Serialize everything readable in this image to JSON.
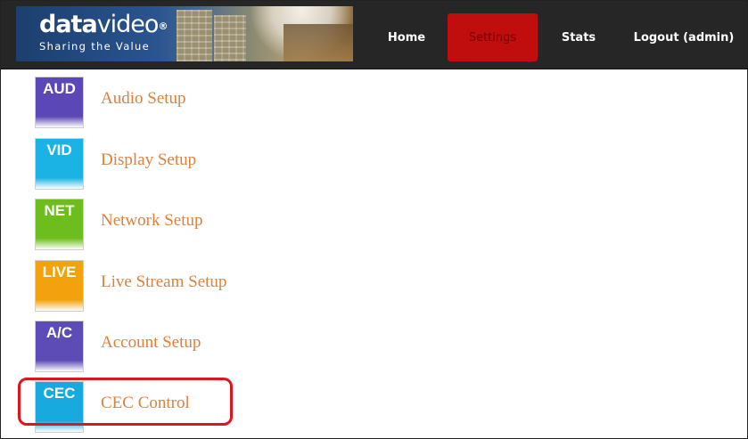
{
  "header": {
    "logo_bold": "data",
    "logo_thin": "video",
    "logo_reg": "®",
    "tagline": "Sharing the Value",
    "nav": [
      {
        "label": "Home",
        "active": false
      },
      {
        "label": "Settings",
        "active": true
      },
      {
        "label": "Stats",
        "active": false
      },
      {
        "label": "Logout (admin)",
        "active": false
      }
    ]
  },
  "menu": [
    {
      "tile": "AUD",
      "label": "Audio Setup",
      "color": "#5b47b5",
      "icon": "audio-tile-icon"
    },
    {
      "tile": "VID",
      "label": "Display Setup",
      "color": "#1ab3e3",
      "icon": "video-tile-icon"
    },
    {
      "tile": "NET",
      "label": "Network Setup",
      "color": "#6ebd1e",
      "icon": "network-tile-icon"
    },
    {
      "tile": "LIVE",
      "label": "Live Stream Setup",
      "color": "#f2a20d",
      "icon": "live-tile-icon"
    },
    {
      "tile": "A/C",
      "label": "Account Setup",
      "color": "#5e4cb6",
      "icon": "account-tile-icon"
    },
    {
      "tile": "CEC",
      "label": "CEC Control",
      "color": "#18a9de",
      "icon": "cec-tile-icon"
    }
  ],
  "colors": {
    "header_bg": "#262626",
    "active_nav": "#c00d0d",
    "link": "#e0803a",
    "highlight": "#e0141b"
  }
}
